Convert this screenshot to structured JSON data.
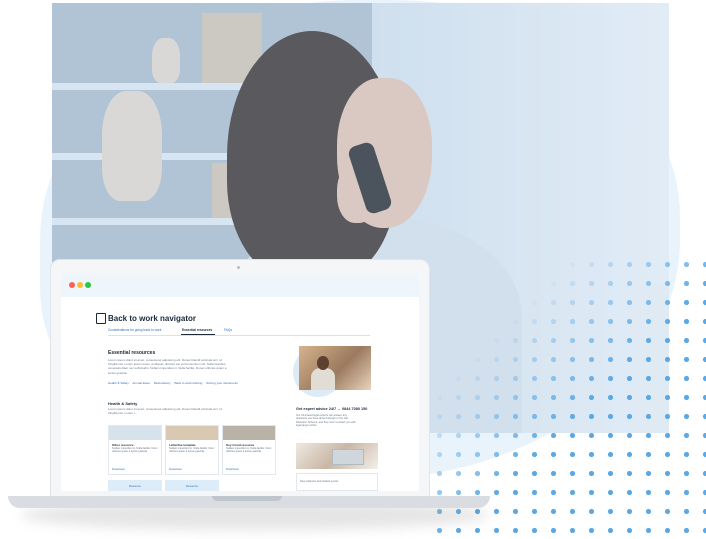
{
  "window": {
    "controls": [
      "close",
      "minimize",
      "maximize"
    ],
    "control_colors": {
      "close": "#ff5f57",
      "minimize": "#febc2e",
      "maximize": "#28c840"
    }
  },
  "navigator": {
    "icon": "document-icon",
    "title": "Back to work navigator",
    "tabs": [
      {
        "label": "Considerations for going back to work",
        "active": false
      },
      {
        "label": "Essential resources",
        "active": true
      },
      {
        "label": "FAQs",
        "active": false
      }
    ]
  },
  "essential": {
    "heading": "Essential resources",
    "lines": [
      "Lorem ipsum dolor sit amet, consectetur adipiscing elit. Donec blandit vehicula orci, id",
      "fringilla nisi. Lorem ipsum lorem ut aliquet, ultricies est vel fermentum nisl. Nulla faucibus",
      "venenatis diam nec sollicitudin. Nullam imperdiet mi. Nulla facilisi. Donec ultricies quam a",
      "luctus gravida."
    ],
    "links": [
      "Health & Safety",
      "Annual leave",
      "Redundancy",
      "Back to work training",
      "Storing your documents"
    ]
  },
  "health": {
    "heading": "Health & Safety",
    "lines": [
      "Lorem ipsum dolor sit amet, consectetur adipiscing elit. Donec blandit vehicula orci, id",
      "fringilla nisi. Lorem i..."
    ],
    "cards": [
      {
        "title": "Other resource",
        "desc": "Nullam imperdiet mi. Nulla facilisi. Nunc ultricies quam a luctus gravida.",
        "action": "Download",
        "button": "Resource"
      },
      {
        "title": "Letter/fax template",
        "desc": "Nullam imperdiet mi. Nulla facilisi. Nunc ultricies quam a luctus gravida.",
        "action": "Download",
        "button": "Resource"
      },
      {
        "title": "Key Covid resource",
        "desc": "Nullam imperdiet mi. Nulla facilisi. Nunc ultricies quam a luctus gravida.",
        "action": "Download",
        "button": ""
      }
    ]
  },
  "sidebar": {
    "heading": "Get expert advice 24/7  →  0844 7080 150",
    "lines": [
      "Our UK-based legal experts can answer any",
      "questions you have about furlough or the Job",
      "Retention Scheme, and they won't contract you with",
      "legal jargon either."
    ],
    "card_text": "New webinars and related events"
  }
}
